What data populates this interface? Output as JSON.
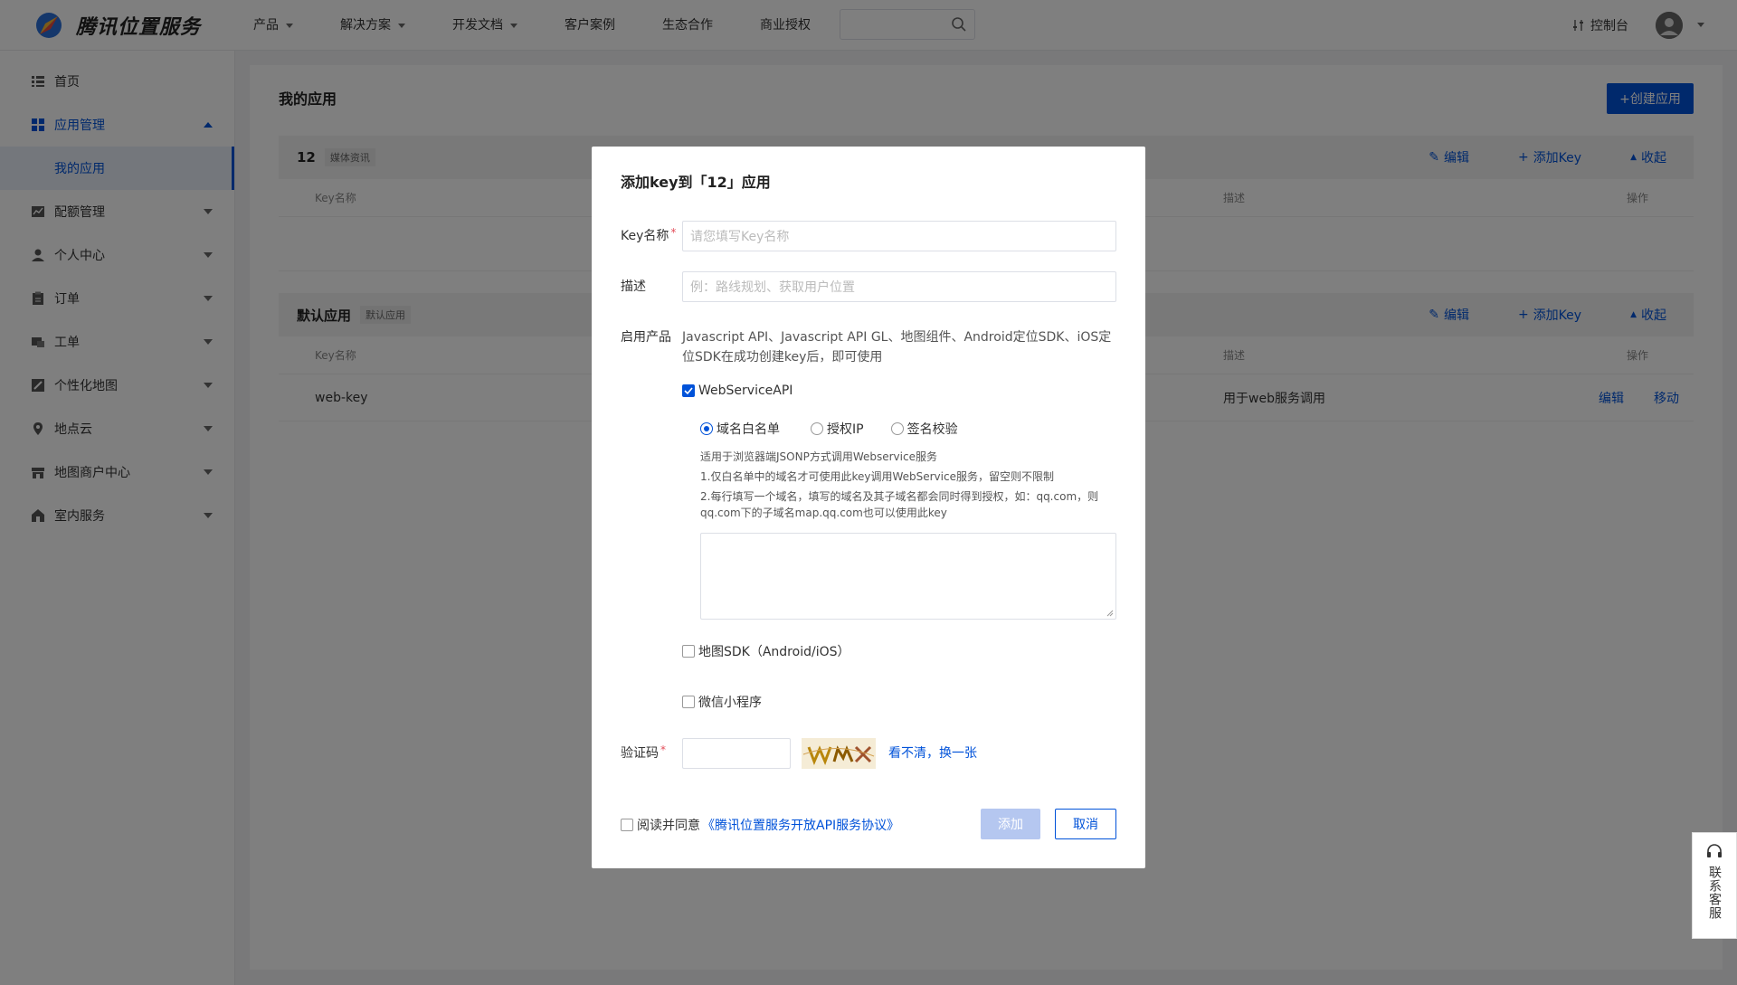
{
  "header": {
    "brand": "腾讯位置服务",
    "nav": [
      {
        "label": "产品",
        "dropdown": true
      },
      {
        "label": "解决方案",
        "dropdown": true
      },
      {
        "label": "开发文档",
        "dropdown": true
      },
      {
        "label": "客户案例",
        "dropdown": false
      },
      {
        "label": "生态合作",
        "dropdown": false
      },
      {
        "label": "商业授权",
        "dropdown": false
      }
    ],
    "search_placeholder": "",
    "console": "控制台"
  },
  "sidebar": {
    "items": [
      {
        "label": "首页",
        "icon": "list-icon"
      },
      {
        "label": "应用管理",
        "icon": "grid-icon"
      },
      {
        "label": "配额管理",
        "icon": "chart-icon"
      },
      {
        "label": "个人中心",
        "icon": "user-icon"
      },
      {
        "label": "订单",
        "icon": "clipboard-icon"
      },
      {
        "label": "工单",
        "icon": "ticket-icon"
      },
      {
        "label": "个性化地图",
        "icon": "map-style-icon"
      },
      {
        "label": "地点云",
        "icon": "pin-icon"
      },
      {
        "label": "地图商户中心",
        "icon": "store-icon"
      },
      {
        "label": "室内服务",
        "icon": "building-icon"
      }
    ],
    "sub_item": "我的应用"
  },
  "main": {
    "title": "我的应用",
    "create_button": "+创建应用",
    "apps": [
      {
        "name": "12",
        "tag": "媒体资讯",
        "actions": {
          "edit": "编辑",
          "add_key": "添加Key",
          "collapse": "收起"
        },
        "columns": {
          "key_name": "Key名称",
          "desc": "描述",
          "ops": "操作"
        },
        "rows": []
      },
      {
        "name": "默认应用",
        "tag": "默认应用",
        "actions": {
          "edit": "编辑",
          "add_key": "添加Key",
          "collapse": "收起"
        },
        "columns": {
          "key_name": "Key名称",
          "desc": "描述",
          "ops": "操作"
        },
        "rows": [
          {
            "key_name": "web-key",
            "desc": "用于web服务调用",
            "edit": "编辑",
            "move": "移动"
          }
        ]
      }
    ]
  },
  "dialog": {
    "title": "添加key到「12」应用",
    "key_name_label": "Key名称",
    "key_name_placeholder": "请您填写Key名称",
    "desc_label": "描述",
    "desc_placeholder": "例：路线规划、获取用户位置",
    "products_label": "启用产品",
    "products_desc": "Javascript API、Javascript API GL、地图组件、Android定位SDK、iOS定位SDK在成功创建key后，即可使用",
    "webservice_label": "WebServiceAPI",
    "webservice_checked": true,
    "auth_options": [
      {
        "label": "域名白名单",
        "selected": true
      },
      {
        "label": "授权IP",
        "selected": false
      },
      {
        "label": "签名校验",
        "selected": false
      }
    ],
    "hint_title": "适用于浏览器端JSONP方式调用Webservice服务",
    "hint_1": "1.仅白名单中的域名才可使用此key调用WebService服务，留空则不限制",
    "hint_2": "2.每行填写一个域名，填写的域名及其子域名都会同时得到授权，如：qq.com，则qq.com下的子域名map.qq.com也可以使用此key",
    "sdk_label": "地图SDK（Android/iOS）",
    "miniprogram_label": "微信小程序",
    "captcha_label": "验证码",
    "captcha_refresh": "看不清，换一张",
    "agree_prefix": "阅读并同意",
    "agree_link": "《腾讯位置服务开放API服务协议》",
    "add_button": "添加",
    "cancel_button": "取消"
  },
  "support": {
    "label": "联系客服"
  },
  "colors": {
    "primary": "#0052d9",
    "required": "#e34d59"
  }
}
